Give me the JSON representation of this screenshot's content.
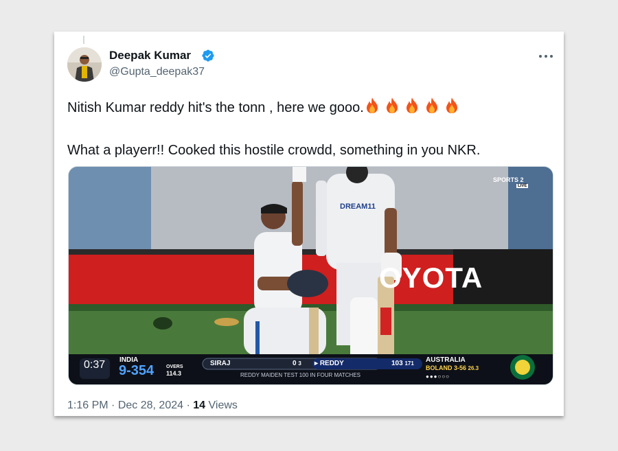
{
  "tweet": {
    "author_name": "Deepak Kumar",
    "handle": "@Gupta_deepak37",
    "text_line1": "Nitish Kumar reddy hit's the tonn , here we gooo.",
    "text_line2": "What a playerr!! Cooked this hostile crowdd, something in you NKR.",
    "emoji": "🔥🔥🔥🔥🔥",
    "time": "1:16 PM",
    "separator": "·",
    "date": "Dec 28, 2024",
    "views_count": "14",
    "views_label": "Views"
  },
  "icons": {
    "verified": "verified-badge-icon",
    "more": "more-options-icon",
    "fire": "fire-emoji"
  },
  "colors": {
    "verified": "#1d9bf0",
    "text": "#0f1419",
    "muted": "#536471",
    "background": "#ebebeb"
  },
  "scoreboard": {
    "clock": "0:37",
    "team1": "INDIA",
    "score": "9-354",
    "overs_label": "OVERS",
    "overs": "114.3",
    "batter1": "SIRAJ",
    "batter1_score": "0",
    "batter1_balls": "3",
    "batter2": "REDDY",
    "batter2_score": "103",
    "batter2_balls": "171",
    "ticker": "REDDY MAIDEN TEST 100 IN FOUR MATCHES",
    "team2": "AUSTRALIA",
    "bowler": "BOLAND",
    "bowler_figures": "3-56",
    "bowler_overs": "26.3",
    "channel": "SPORTS 2",
    "live": "LIVE",
    "sponsor": "OYOTA",
    "jersey_text": "DREAM11"
  }
}
